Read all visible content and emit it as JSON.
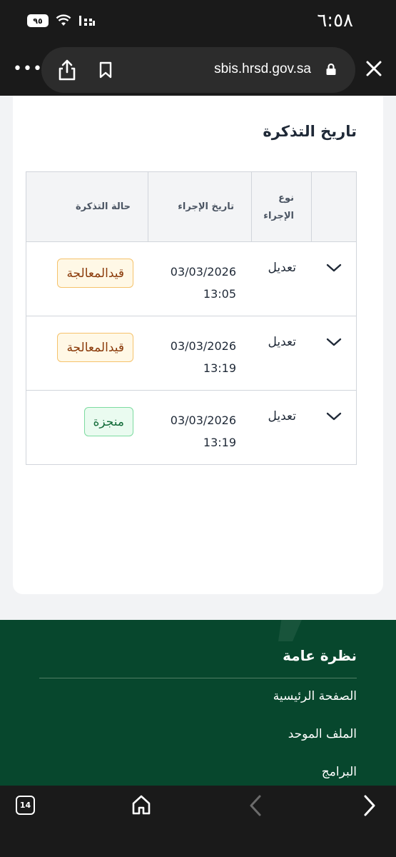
{
  "status_bar": {
    "time": "٦:٥٨",
    "battery": "٩٥"
  },
  "browser": {
    "url": "sbis.hrsd.gov.sa",
    "menu": "•••"
  },
  "card": {
    "title": "تاريخ التذكرة",
    "table": {
      "headers": {
        "type": "نوع\nالإجراء",
        "date": "تاريخ الإجراء",
        "status": "حالة التذكرة"
      },
      "rows": [
        {
          "type": "تعديل",
          "date": "03/03/2026\n13:05",
          "status": "قيدالمعالجة",
          "status_kind": "pending"
        },
        {
          "type": "تعديل",
          "date": "03/03/2026\n13:19",
          "status": "قيدالمعالجة",
          "status_kind": "pending"
        },
        {
          "type": "تعديل",
          "date": "03/03/2026\n13:19",
          "status": "منجزة",
          "status_kind": "done"
        }
      ]
    }
  },
  "footer": {
    "title": "نظرة عامة",
    "links": [
      "الصفحة الرئيسية",
      "الملف الموحد",
      "البرامج"
    ]
  },
  "bottom_nav": {
    "tabs_count": "14"
  },
  "colors": {
    "footer_bg": "#07472d",
    "pending_badge": "#fff8e6",
    "done_badge": "#eafbf0"
  },
  "icons": [
    "share-icon",
    "bookmark-icon",
    "lock-icon",
    "close-icon",
    "chevron-down-icon",
    "home-icon",
    "back-icon",
    "forward-icon",
    "wifi-icon",
    "signal-icon"
  ]
}
